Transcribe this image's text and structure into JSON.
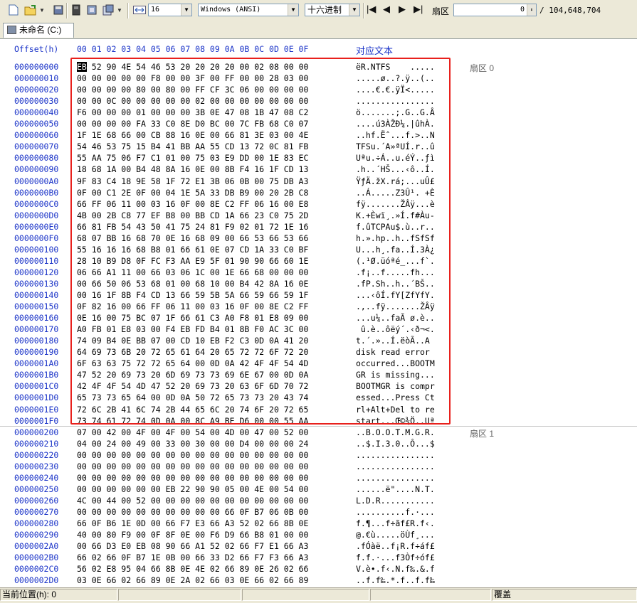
{
  "toolbar": {
    "font_size": "16",
    "charset": "Windows (ANSI)",
    "mode": "十六进制",
    "sector_label": "扇区",
    "sector_value": "0",
    "sector_total": "/ 104,648,704"
  },
  "tab": {
    "label": "未命名 (C:)"
  },
  "header": {
    "offset_label": "Offset(h)",
    "columns": "00 01 02 03 04 05 06 07 08 09 0A 0B 0C 0D 0E 0F",
    "text_label": "对应文本"
  },
  "rows": [
    {
      "off": "000000000",
      "hex": "EB 52 90 4E 54 46 53 20 20 20 20 00 02 08 00 00",
      "asc": "ëR.NTFS    .....",
      "sec": "扇区 0"
    },
    {
      "off": "000000010",
      "hex": "00 00 00 00 00 F8 00 00 3F 00 FF 00 00 28 03 00",
      "asc": ".....ø..?.ÿ..(..",
      "sec": ""
    },
    {
      "off": "000000020",
      "hex": "00 00 00 00 80 00 80 00 FF CF 3C 06 00 00 00 00",
      "asc": "....€.€.ÿÏ<.....",
      "sec": ""
    },
    {
      "off": "000000030",
      "hex": "00 00 0C 00 00 00 00 00 02 00 00 00 00 00 00 00",
      "asc": "................",
      "sec": ""
    },
    {
      "off": "000000040",
      "hex": "F6 00 00 00 01 00 00 00 3B 0E 47 08 1B 47 08 C2",
      "asc": "ö.......;.G..G.Â",
      "sec": ""
    },
    {
      "off": "000000050",
      "hex": "00 00 00 00 FA 33 C0 8E D0 BC 00 7C FB 68 C0 07",
      "asc": "....ú3ÀŽÐ¼.|ûhÀ.",
      "sec": ""
    },
    {
      "off": "000000060",
      "hex": "1F 1E 68 66 00 CB 88 16 0E 00 66 81 3E 03 00 4E",
      "asc": "..hf.Ëˆ...f.>..N",
      "sec": ""
    },
    {
      "off": "000000070",
      "hex": "54 46 53 75 15 B4 41 BB AA 55 CD 13 72 0C 81 FB",
      "asc": "TFSu.´A»ªUÍ.r..û",
      "sec": ""
    },
    {
      "off": "000000080",
      "hex": "55 AA 75 06 F7 C1 01 00 75 03 E9 DD 00 1E 83 EC",
      "asc": "Uªu.÷Á..u.éÝ..ƒì",
      "sec": ""
    },
    {
      "off": "000000090",
      "hex": "18 68 1A 00 B4 48 8A 16 0E 00 8B F4 16 1F CD 13",
      "asc": ".h..´HŠ...‹ô..Í.",
      "sec": ""
    },
    {
      "off": "0000000A0",
      "hex": "9F 83 C4 18 9E 58 1F 72 E1 3B 06 0B 00 75 DB A3",
      "asc": "ŸƒÄ.žX.rá;...uÛ£",
      "sec": ""
    },
    {
      "off": "0000000B0",
      "hex": "0F 00 C1 2E 0F 00 04 1E 5A 33 DB B9 00 20 2B C8",
      "asc": "..Á.....Z3Û¹. +È",
      "sec": ""
    },
    {
      "off": "0000000C0",
      "hex": "66 FF 06 11 00 03 16 0F 00 8E C2 FF 06 16 00 E8",
      "asc": "fÿ.......ŽÂÿ...è",
      "sec": ""
    },
    {
      "off": "0000000D0",
      "hex": "4B 00 2B C8 77 EF B8 00 BB CD 1A 66 23 C0 75 2D",
      "asc": "K.+Èwï¸.»Í.f#Àu-",
      "sec": ""
    },
    {
      "off": "0000000E0",
      "hex": "66 81 FB 54 43 50 41 75 24 81 F9 02 01 72 1E 16",
      "asc": "f.ûTCPAu$.ù..r..",
      "sec": ""
    },
    {
      "off": "0000000F0",
      "hex": "68 07 BB 16 68 70 0E 16 68 09 00 66 53 66 53 66",
      "asc": "h.».hp..h..fSfSf",
      "sec": ""
    },
    {
      "off": "000000100",
      "hex": "55 16 16 16 68 B8 01 66 61 0E 07 CD 1A 33 C0 BF",
      "asc": "U...h¸.fa..Í.3À¿",
      "sec": ""
    },
    {
      "off": "000000110",
      "hex": "28 10 B9 D8 0F FC F3 AA E9 5F 01 90 90 66 60 1E",
      "asc": "(.¹Ø.üóªé_...f`.",
      "sec": ""
    },
    {
      "off": "000000120",
      "hex": "06 66 A1 11 00 66 03 06 1C 00 1E 66 68 00 00 00",
      "asc": ".f¡..f.....fh...",
      "sec": ""
    },
    {
      "off": "000000130",
      "hex": "00 66 50 06 53 68 01 00 68 10 00 B4 42 8A 16 0E",
      "asc": ".fP.Sh..h..´BŠ..",
      "sec": ""
    },
    {
      "off": "000000140",
      "hex": "00 16 1F 8B F4 CD 13 66 59 5B 5A 66 59 66 59 1F",
      "asc": "...‹ôÍ.fY[ZfYfY.",
      "sec": ""
    },
    {
      "off": "000000150",
      "hex": "0F 82 16 00 66 FF 06 11 00 03 16 0F 00 8E C2 FF",
      "asc": ".‚..fÿ.......ŽÂÿ",
      "sec": ""
    },
    {
      "off": "000000160",
      "hex": "0E 16 00 75 BC 07 1F 66 61 C3 A0 F8 01 E8 09 00",
      "asc": "...u¼..faÃ ø.è..",
      "sec": ""
    },
    {
      "off": "000000170",
      "hex": "A0 FB 01 E8 03 00 F4 EB FD B4 01 8B F0 AC 3C 00",
      "asc": " û.è..ôëý´.‹ð¬<.",
      "sec": ""
    },
    {
      "off": "000000180",
      "hex": "74 09 B4 0E BB 07 00 CD 10 EB F2 C3 0D 0A 41 20",
      "asc": "t.´.»..Í.ëòÃ..A ",
      "sec": ""
    },
    {
      "off": "000000190",
      "hex": "64 69 73 6B 20 72 65 61 64 20 65 72 72 6F 72 20",
      "asc": "disk read error ",
      "sec": ""
    },
    {
      "off": "0000001A0",
      "hex": "6F 63 63 75 72 72 65 64 00 0D 0A 42 4F 4F 54 4D",
      "asc": "occurred...BOOTM",
      "sec": ""
    },
    {
      "off": "0000001B0",
      "hex": "47 52 20 69 73 20 6D 69 73 73 69 6E 67 00 0D 0A",
      "asc": "GR is missing...",
      "sec": ""
    },
    {
      "off": "0000001C0",
      "hex": "42 4F 4F 54 4D 47 52 20 69 73 20 63 6F 6D 70 72",
      "asc": "BOOTMGR is compr",
      "sec": ""
    },
    {
      "off": "0000001D0",
      "hex": "65 73 73 65 64 00 0D 0A 50 72 65 73 73 20 43 74",
      "asc": "essed...Press Ct",
      "sec": ""
    },
    {
      "off": "0000001E0",
      "hex": "72 6C 2B 41 6C 74 2B 44 65 6C 20 74 6F 20 72 65",
      "asc": "rl+Alt+Del to re",
      "sec": ""
    },
    {
      "off": "0000001F0",
      "hex": "73 74 61 72 74 0D 0A 00 8C A9 BE D6 00 00 55 AA",
      "asc": "start...Œ©¾Ö..Uª",
      "sec": ""
    },
    {
      "off": "000000200",
      "hex": "07 00 42 00 4F 00 4F 00 54 00 4D 00 47 00 52 00",
      "asc": "..B.O.O.T.M.G.R.",
      "sec": "扇区 1"
    },
    {
      "off": "000000210",
      "hex": "04 00 24 00 49 00 33 00 30 00 00 D4 00 00 00 24",
      "asc": "..$.I.3.0..Ô...$",
      "sec": ""
    },
    {
      "off": "000000220",
      "hex": "00 00 00 00 00 00 00 00 00 00 00 00 00 00 00 00",
      "asc": "................",
      "sec": ""
    },
    {
      "off": "000000230",
      "hex": "00 00 00 00 00 00 00 00 00 00 00 00 00 00 00 00",
      "asc": "................",
      "sec": ""
    },
    {
      "off": "000000240",
      "hex": "00 00 00 00 00 00 00 00 00 00 00 00 00 00 00 00",
      "asc": "................",
      "sec": ""
    },
    {
      "off": "000000250",
      "hex": "00 00 00 00 00 00 EB 22 90 90 05 00 4E 00 54 00",
      "asc": "......ë\"....N.T.",
      "sec": ""
    },
    {
      "off": "000000260",
      "hex": "4C 00 44 00 52 00 00 00 00 00 00 00 00 00 00 00",
      "asc": "L.D.R...........",
      "sec": ""
    },
    {
      "off": "000000270",
      "hex": "00 00 00 00 00 00 00 00 00 00 66 0F B7 06 0B 00",
      "asc": "..........f.·...",
      "sec": ""
    },
    {
      "off": "000000280",
      "hex": "66 0F B6 1E 0D 00 66 F7 E3 66 A3 52 02 66 8B 0E",
      "asc": "f.¶...f÷ãf£R.f‹.",
      "sec": ""
    },
    {
      "off": "000000290",
      "hex": "40 00 80 F9 00 0F 8F 0E 00 F6 D9 66 B8 01 00 00",
      "asc": "@.€ù.....öÙf¸...",
      "sec": ""
    },
    {
      "off": "0000002A0",
      "hex": "00 66 D3 E0 EB 08 90 66 A1 52 02 66 F7 E1 66 A3",
      "asc": ".fÓàë..f¡R.f÷áf£",
      "sec": ""
    },
    {
      "off": "0000002B0",
      "hex": "66 02 66 0F B7 1E 0B 00 66 33 D2 66 F7 F3 66 A3",
      "asc": "f.f.·...f3Òf÷óf£",
      "sec": ""
    },
    {
      "off": "0000002C0",
      "hex": "56 02 E8 95 04 66 8B 0E 4E 02 66 89 0E 26 02 66",
      "asc": "V.è•.f‹.N.f‰.&.f",
      "sec": ""
    },
    {
      "off": "0000002D0",
      "hex": "03 0E 66 02 66 89 0E 2A 02 66 03 0E 66 02 66 89",
      "asc": "..f.f‰.*.f..f.f‰",
      "sec": ""
    }
  ],
  "status": {
    "position": "当前位置(h): 0",
    "mode": "覆盖"
  }
}
